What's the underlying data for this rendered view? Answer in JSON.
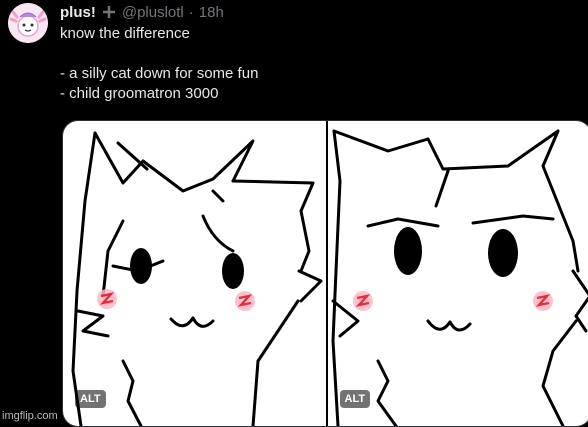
{
  "post": {
    "author_name": "plus!",
    "handle": "@pluslotl",
    "separator": "·",
    "time": "18h",
    "lines": [
      "know the difference",
      "",
      "- a silly cat down for some fun",
      "- child groomatron 3000"
    ]
  },
  "media": {
    "left_alt_label": "ALT",
    "right_alt_label": "ALT"
  },
  "icons": {
    "avatar": "axolotl-avatar-icon",
    "subscription": "subscription-plus-icon"
  },
  "watermark": "imgflip.com",
  "colors": {
    "background": "#000000",
    "text": "#e7e9ea",
    "muted": "#71767b",
    "blush": "#e03040"
  }
}
